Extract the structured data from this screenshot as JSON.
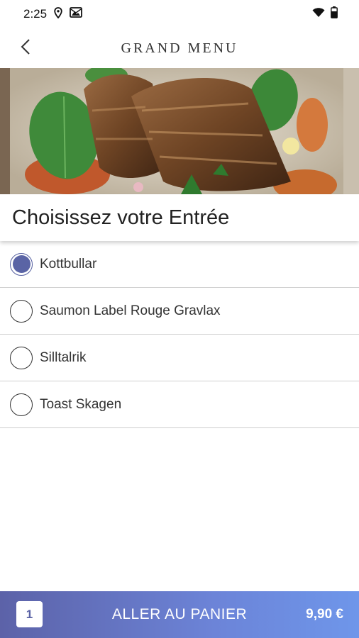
{
  "status_bar": {
    "time": "2:25",
    "icons": [
      "location-pin-icon",
      "gallery-icon",
      "wifi-icon",
      "battery-icon"
    ]
  },
  "app_bar": {
    "title": "GRAND MENU",
    "back_icon": "chevron-left-icon"
  },
  "hero": {
    "image_subject": "grilled pork ribs with spinach leaves and sauce"
  },
  "section": {
    "title": "Choisissez votre Entrée"
  },
  "options": [
    {
      "label": "Kottbullar",
      "selected": true
    },
    {
      "label": "Saumon Label Rouge Gravlax",
      "selected": false
    },
    {
      "label": "Silltalrik",
      "selected": false
    },
    {
      "label": "Toast Skagen",
      "selected": false
    }
  ],
  "cart": {
    "count": "1",
    "label": "ALLER AU PANIER",
    "price": "9,90 €"
  },
  "colors": {
    "accent": "#5a64a5",
    "bar_gradient_start": "#5c62a8",
    "bar_gradient_end": "#6e96ea"
  }
}
